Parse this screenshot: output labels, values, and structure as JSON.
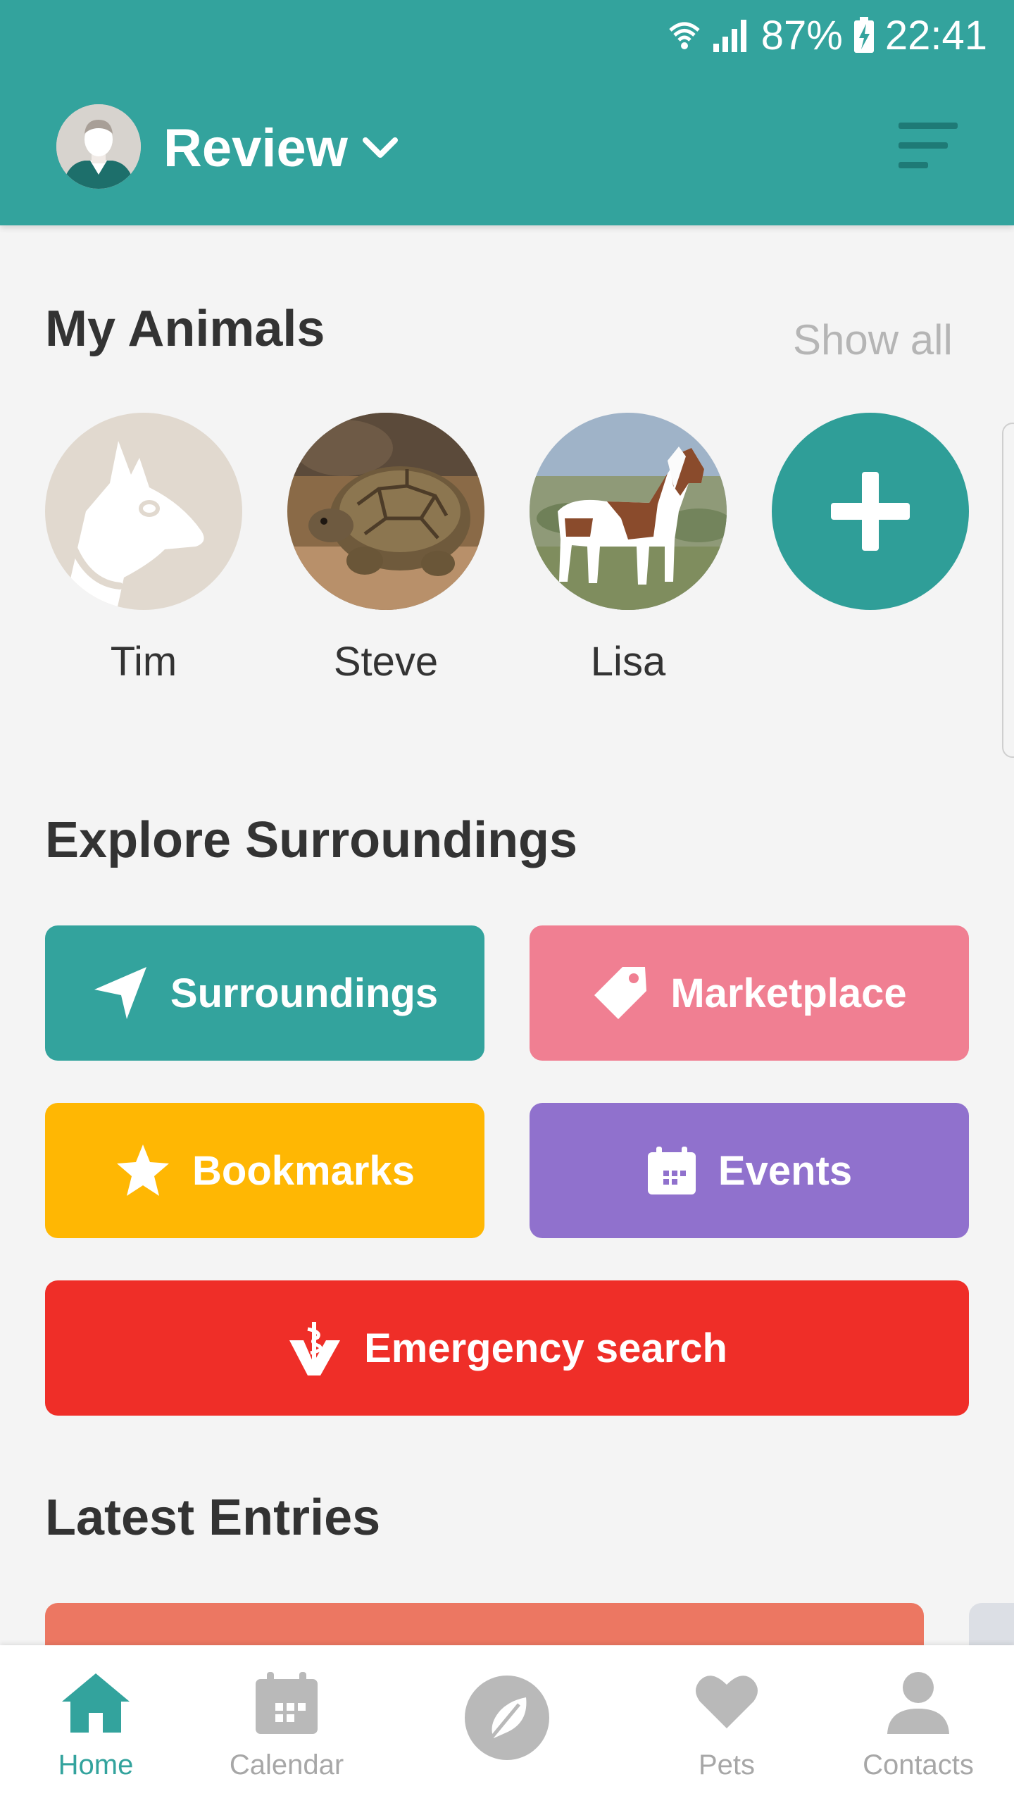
{
  "status_bar": {
    "battery": "87%",
    "time": "22:41"
  },
  "header": {
    "account_name": "Review"
  },
  "my_animals": {
    "title": "My Animals",
    "show_all": "Show all",
    "animals": [
      {
        "name": "Tim"
      },
      {
        "name": "Steve"
      },
      {
        "name": "Lisa"
      }
    ]
  },
  "explore": {
    "title": "Explore Surroundings",
    "buttons": {
      "surroundings": "Surroundings",
      "marketplace": "Marketplace",
      "bookmarks": "Bookmarks",
      "events": "Events",
      "emergency": "Emergency search"
    },
    "colors": {
      "surroundings": "#33a39d",
      "marketplace": "#f07f92",
      "bookmarks": "#ffb703",
      "events": "#9071cd",
      "emergency": "#ef2e28"
    }
  },
  "latest_entries": {
    "title": "Latest Entries"
  },
  "bottom_nav": {
    "home": "Home",
    "calendar": "Calendar",
    "pets": "Pets",
    "contacts": "Contacts"
  },
  "colors": {
    "primary": "#33a39d",
    "background": "#f4f4f4"
  }
}
